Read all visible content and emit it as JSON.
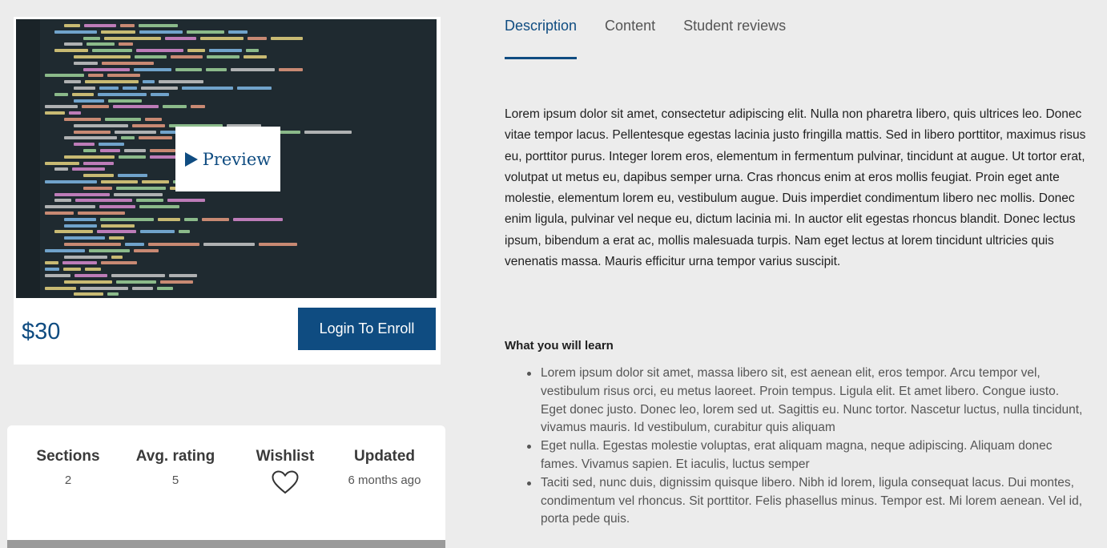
{
  "course": {
    "preview_label": "Preview",
    "price": "$30",
    "enroll_label": "Login To Enroll"
  },
  "stats": {
    "sections_label": "Sections",
    "sections_value": "2",
    "rating_label": "Avg. rating",
    "rating_value": "5",
    "wishlist_label": "Wishlist",
    "updated_label": "Updated",
    "updated_value": "6 months ago"
  },
  "tabs": [
    {
      "label": "Description",
      "active": true
    },
    {
      "label": "Content",
      "active": false
    },
    {
      "label": "Student reviews",
      "active": false
    }
  ],
  "description": "Lorem ipsum dolor sit amet, consectetur adipiscing elit. Nulla non pharetra libero, quis ultrices leo. Donec vitae tempor lacus. Pellentesque egestas lacinia justo fringilla mattis. Sed in libero porttitor, maximus risus eu, porttitor purus. Integer lorem eros, elementum in fermentum pulvinar, tincidunt at augue. Ut tortor erat, volutpat ut metus eu, dapibus semper urna. Cras rhoncus enim at eros mollis feugiat. Proin eget ante molestie, elementum lorem eu, vestibulum augue. Duis imperdiet condimentum libero nec mollis. Donec enim ligula, pulvinar vel neque eu, dictum lacinia mi. In auctor elit egestas rhoncus blandit. Donec lectus ipsum, bibendum a erat ac, mollis malesuada turpis. Nam eget lectus at lorem tincidunt ultricies quis venenatis massa. Mauris efficitur urna tempor varius suscipit.",
  "learn": {
    "heading": "What you will learn",
    "items": [
      "Lorem ipsum dolor sit amet, massa libero sit, est aenean elit, eros tempor. Arcu tempor vel, vestibulum risus orci, eu metus laoreet. Proin tempus. Ligula elit. Et amet libero. Congue iusto. Eget donec justo. Donec leo, lorem sed ut. Sagittis eu. Nunc tortor. Nascetur luctus, nulla tincidunt, vivamus mauris. Id vestibulum, curabitur quis aliquam",
      "Eget nulla. Egestas molestie voluptas, erat aliquam magna, neque adipiscing. Aliquam donec fames. Vivamus sapien. Et iaculis, luctus semper",
      "Taciti sed, nunc duis, dignissim quisque libero. Nibh id lorem, ligula consequat lacus. Dui montes, condimentum vel rhoncus. Sit porttitor. Felis phasellus minus. Tempor est. Mi lorem aenean. Vel id, porta pede quis."
    ]
  },
  "colors": {
    "accent": "#0f4c81",
    "background": "#ececec"
  }
}
